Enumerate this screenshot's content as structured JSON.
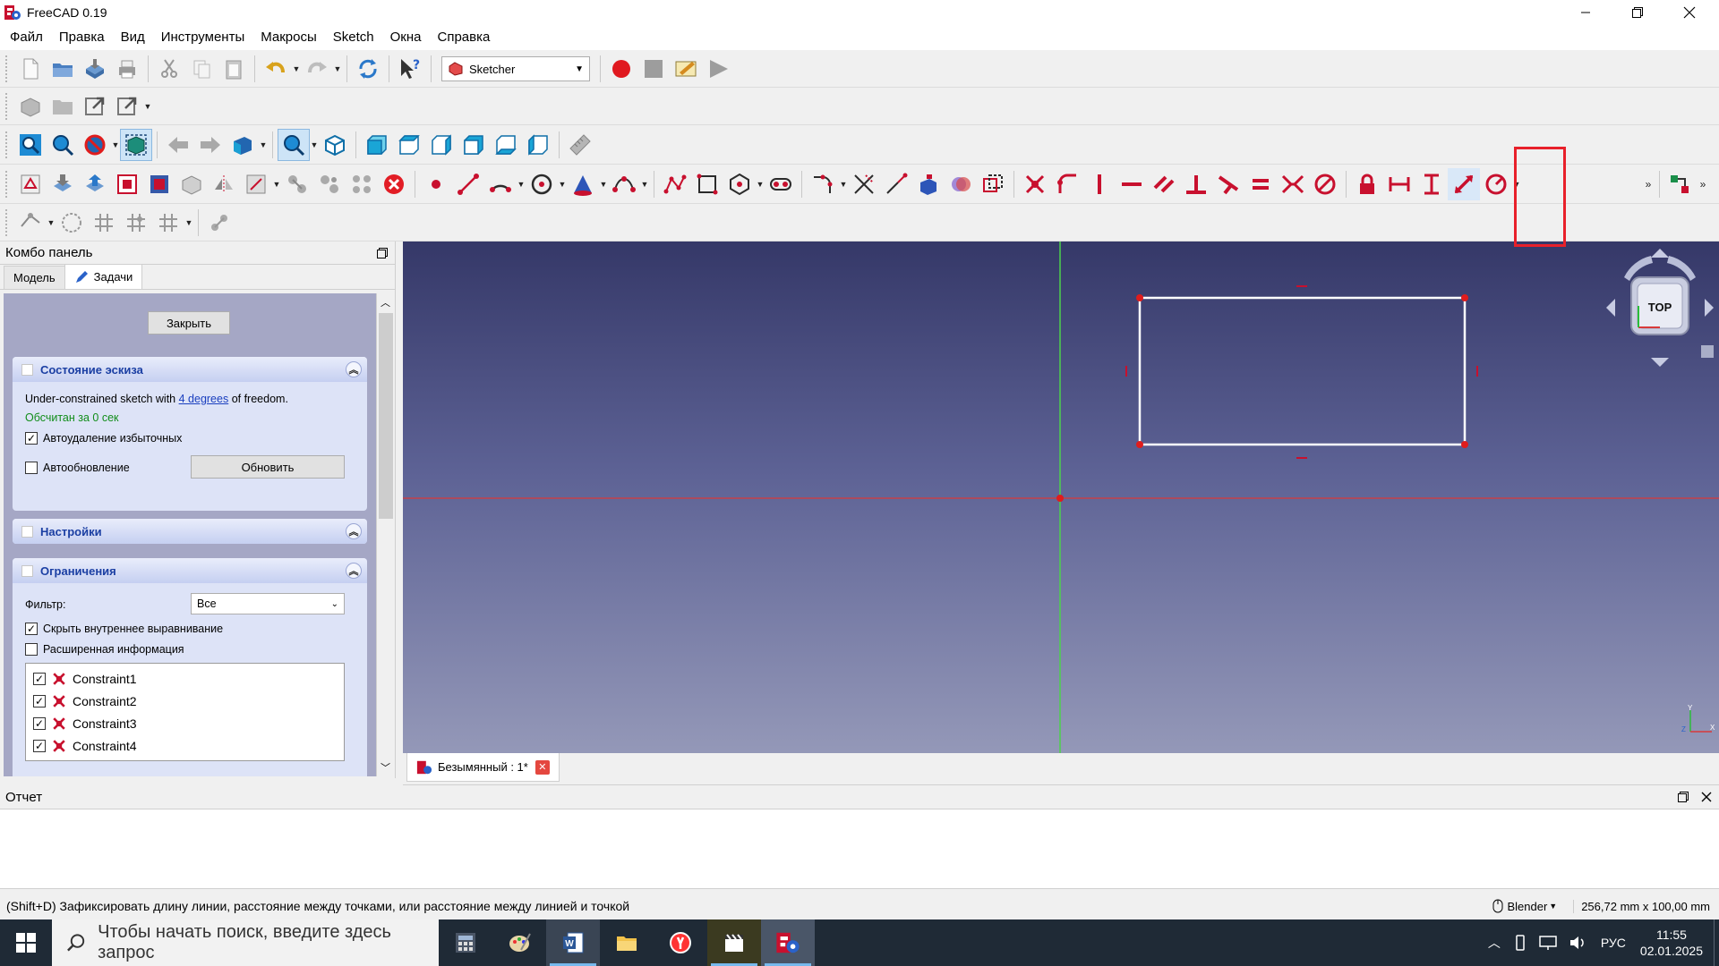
{
  "window": {
    "title": "FreeCAD 0.19"
  },
  "menu": {
    "items": [
      "Файл",
      "Правка",
      "Вид",
      "Инструменты",
      "Макросы",
      "Sketch",
      "Окна",
      "Справка"
    ]
  },
  "toolbar": {
    "workbench": "Sketcher"
  },
  "combo": {
    "title": "Комбо панель",
    "tab_model": "Модель",
    "tab_tasks": "Задачи",
    "close_button": "Закрыть",
    "sketch_state": {
      "title": "Состояние эскиза",
      "status_prefix": "Under-constrained sketch with ",
      "status_link": "4 degrees",
      "status_suffix": " of freedom.",
      "solved": "Обсчитан за 0 сек",
      "auto_remove": "Автоудаление избыточных",
      "auto_update": "Автообновление",
      "update_button": "Обновить"
    },
    "settings": {
      "title": "Настройки"
    },
    "constraints": {
      "title": "Ограничения",
      "filter_label": "Фильтр:",
      "filter_value": "Все",
      "hide_internal": "Скрыть внутреннее выравнивание",
      "extended_info": "Расширенная информация",
      "items": [
        "Constraint1",
        "Constraint2",
        "Constraint3",
        "Constraint4"
      ]
    }
  },
  "view": {
    "navcube_label": "TOP",
    "axis_y": "Y",
    "axis_z": "Z",
    "axis_x": "X"
  },
  "doctab": {
    "label": "Безымянный : 1*"
  },
  "report": {
    "title": "Отчет"
  },
  "status": {
    "message": "(Shift+D) Зафиксировать длину линии, расстояние между точками, или расстояние между линией и точкой",
    "nav_style": "Blender",
    "dimensions": "256,72 mm x 100,00 mm"
  },
  "taskbar": {
    "search_placeholder": "Чтобы начать поиск, введите здесь запрос",
    "lang": "РУС",
    "time": "11:55",
    "date": "02.01.2025"
  },
  "colors": {
    "constraint_red": "#c8102e",
    "highlight": "#e8202a",
    "panel_blue": "#1b3fa3"
  }
}
